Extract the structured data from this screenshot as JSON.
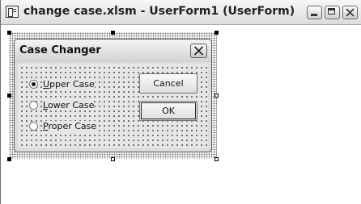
{
  "window": {
    "title": "change case.xlsm - UserForm1 (UserForm)",
    "icon": "userform-icon",
    "controls": [
      "minimize",
      "maximize",
      "close"
    ]
  },
  "form": {
    "title": "Case Changer",
    "options": [
      {
        "label": "Upper Case",
        "selected": true
      },
      {
        "label": "Lower Case",
        "selected": false
      },
      {
        "label": "Proper Case",
        "selected": false
      }
    ],
    "buttons": {
      "cancel": "Cancel",
      "ok": "OK"
    }
  },
  "colors": {
    "form_background": "#dcdcdc",
    "grid_dots": "#555555"
  }
}
